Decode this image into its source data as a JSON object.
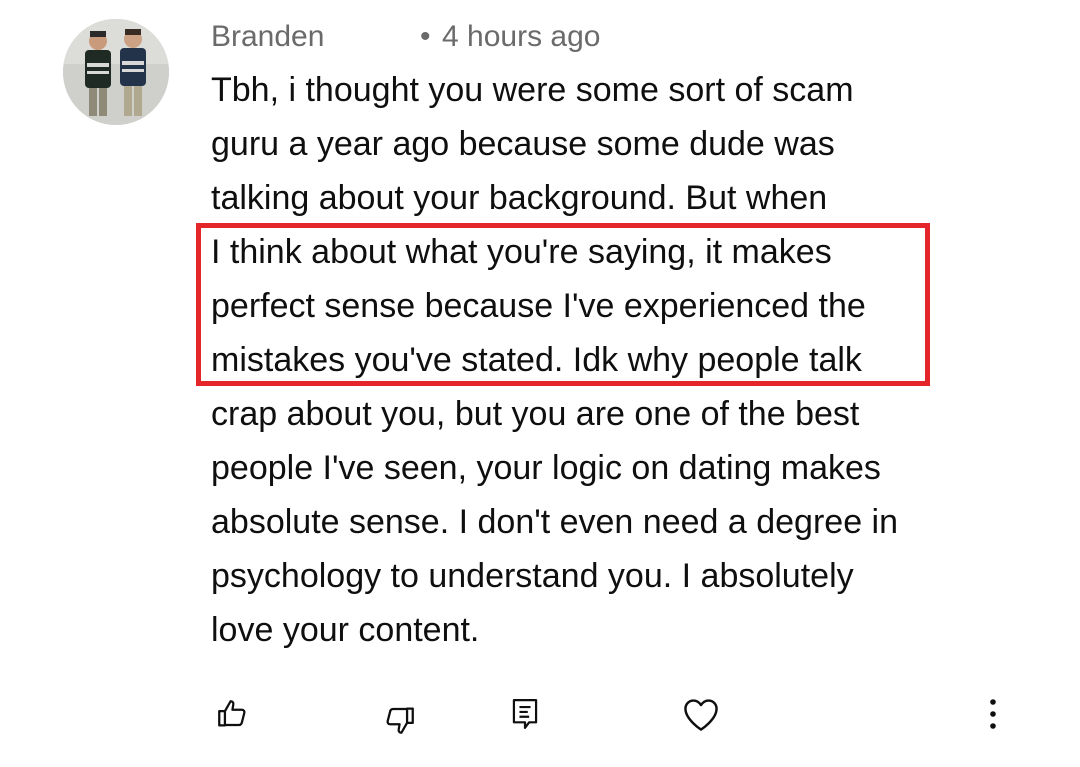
{
  "comment": {
    "author": "Branden",
    "separator": "•",
    "timestamp": "4 hours ago",
    "lines": [
      "Tbh, i thought you were some sort of scam",
      "guru a year ago because some dude was",
      "talking about your background. But when",
      "I think about what you're saying, it makes",
      "perfect sense because I've experienced the",
      "mistakes you've stated. Idk why people talk",
      "crap about you, but you are one of the best",
      "people I've seen, your logic on dating makes",
      "absolute sense. I don't even need a degree in",
      "psychology to understand you. I absolutely",
      "love your content."
    ]
  },
  "highlight": {
    "color": "#e4252a"
  },
  "actions": [
    {
      "name": "like-button",
      "icon": "thumbs-up-icon"
    },
    {
      "name": "dislike-button",
      "icon": "thumbs-down-icon"
    },
    {
      "name": "reply-button",
      "icon": "reply-comment-icon"
    },
    {
      "name": "heart-button",
      "icon": "heart-icon"
    },
    {
      "name": "more-options-button",
      "icon": "vertical-dots-icon"
    }
  ]
}
